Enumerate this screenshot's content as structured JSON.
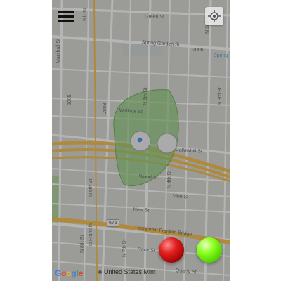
{
  "map": {
    "streets": {
      "green_st": "Green St",
      "spring_garden_st": "Spring Garden St",
      "spring_badge": "Spring",
      "wallace_st": "Wallace St",
      "callowhill_st": "Callowhill St",
      "wood_st": "Wood St",
      "vine_st": "Vine St",
      "new_st": "New St",
      "benjamin_franklin_bridge": "Benjamin Franklin Bridge",
      "race_st": "Race St",
      "quarry_st": "Quarry St",
      "marshall_st": "Marshall St",
      "n_5th_st": "N 5th St",
      "n_4th_st": "N 4th St",
      "n_3rd_st": "N 3rd St",
      "n_2nd_st": "N 2nd St",
      "n_6th_st": "N 6th St",
      "n_franklin": "N Franklin",
      "n_8th_st": "N 8th St",
      "n_7th_st": "N 7th St",
      "fifth_st": "5th St"
    },
    "route_badges": {
      "i676": "676"
    },
    "address_numbers": {
      "n_2006": "2006",
      "n_2005": "2005",
      "n_2003": "2003"
    },
    "attribution": {
      "google_letters": [
        "G",
        "o",
        "o",
        "g",
        "l",
        "e"
      ],
      "poi_label": "United States Mint"
    },
    "colors": {
      "map_base": "#d6d6d0",
      "road": "#ffffff",
      "highway": "#f5b83d",
      "zone_fill": "#7cc462",
      "zone_stroke": "#5fa84a",
      "location_dot": "#4285f4",
      "red_button": "#e02020",
      "green_button": "#66e60f"
    }
  },
  "controls": {
    "menu_icon": "hamburger-menu-icon",
    "locate_icon": "crosshair-icon"
  }
}
